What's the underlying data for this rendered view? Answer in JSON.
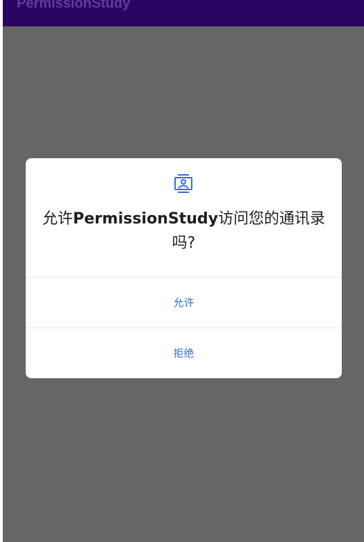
{
  "app_bar": {
    "title": "PermissionStudy",
    "color": "#2a0561"
  },
  "dialog": {
    "icon": "contacts-icon",
    "message_prefix": "允许",
    "app_name": "PermissionStudy",
    "message_suffix": "访问您的通讯录吗?",
    "allow_label": "允许",
    "deny_label": "拒绝",
    "accent_color": "#2f6fdc"
  },
  "scrim_color": "#666666"
}
